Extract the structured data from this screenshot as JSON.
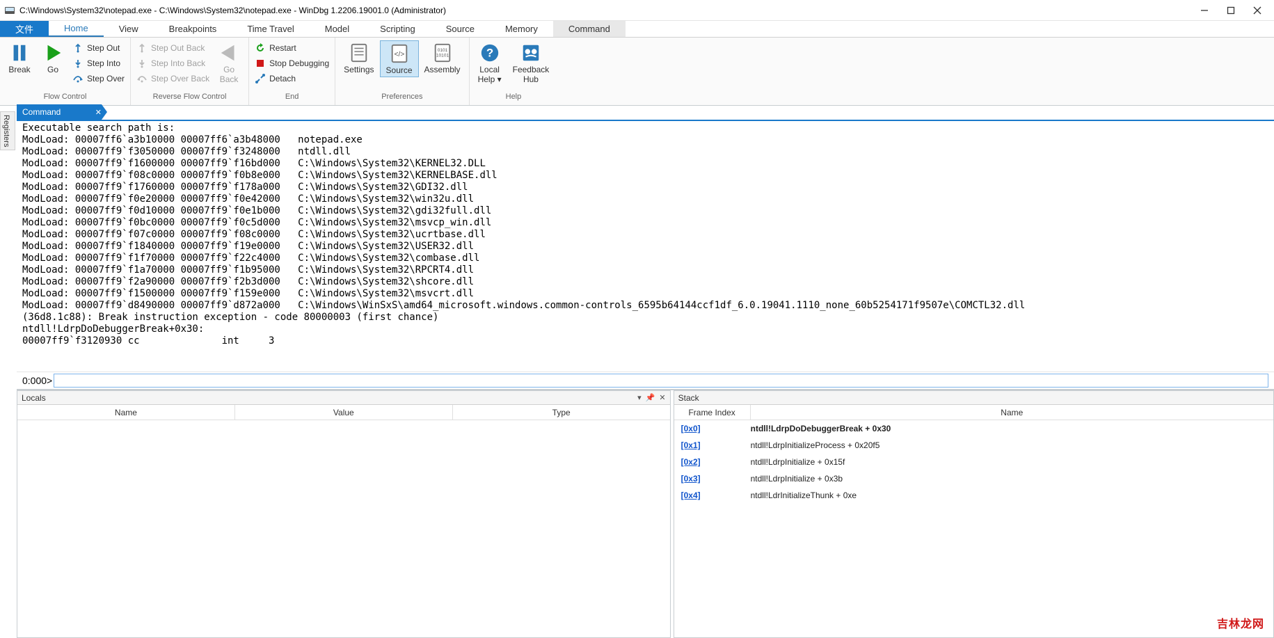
{
  "title": "C:\\Windows\\System32\\notepad.exe - C:\\Windows\\System32\\notepad.exe - WinDbg 1.2206.19001.0 (Administrator)",
  "tabs": {
    "file": "文件",
    "home": "Home",
    "view": "View",
    "breakpoints": "Breakpoints",
    "timetravel": "Time Travel",
    "model": "Model",
    "scripting": "Scripting",
    "source": "Source",
    "memory": "Memory",
    "command": "Command"
  },
  "ribbon": {
    "flow": {
      "label": "Flow Control",
      "break": "Break",
      "go": "Go",
      "stepout": "Step Out",
      "stepinto": "Step Into",
      "stepover": "Step Over"
    },
    "reverse": {
      "label": "Reverse Flow Control",
      "goback": "Go\nBack",
      "stepoutback": "Step Out Back",
      "stepintoback": "Step Into Back",
      "stepoverback": "Step Over Back"
    },
    "end": {
      "label": "End",
      "restart": "Restart",
      "stop": "Stop Debugging",
      "detach": "Detach"
    },
    "prefs": {
      "label": "Preferences",
      "settings": "Settings",
      "source": "Source",
      "assembly": "Assembly"
    },
    "help": {
      "label": "Help",
      "localhelp": "Local\nHelp",
      "feedback": "Feedback\nHub"
    }
  },
  "sidetab": "Registers",
  "command_panel": "Command",
  "command_output": "Executable search path is:\nModLoad: 00007ff6`a3b10000 00007ff6`a3b48000   notepad.exe\nModLoad: 00007ff9`f3050000 00007ff9`f3248000   ntdll.dll\nModLoad: 00007ff9`f1600000 00007ff9`f16bd000   C:\\Windows\\System32\\KERNEL32.DLL\nModLoad: 00007ff9`f08c0000 00007ff9`f0b8e000   C:\\Windows\\System32\\KERNELBASE.dll\nModLoad: 00007ff9`f1760000 00007ff9`f178a000   C:\\Windows\\System32\\GDI32.dll\nModLoad: 00007ff9`f0e20000 00007ff9`f0e42000   C:\\Windows\\System32\\win32u.dll\nModLoad: 00007ff9`f0d10000 00007ff9`f0e1b000   C:\\Windows\\System32\\gdi32full.dll\nModLoad: 00007ff9`f0bc0000 00007ff9`f0c5d000   C:\\Windows\\System32\\msvcp_win.dll\nModLoad: 00007ff9`f07c0000 00007ff9`f08c0000   C:\\Windows\\System32\\ucrtbase.dll\nModLoad: 00007ff9`f1840000 00007ff9`f19e0000   C:\\Windows\\System32\\USER32.dll\nModLoad: 00007ff9`f1f70000 00007ff9`f22c4000   C:\\Windows\\System32\\combase.dll\nModLoad: 00007ff9`f1a70000 00007ff9`f1b95000   C:\\Windows\\System32\\RPCRT4.dll\nModLoad: 00007ff9`f2a90000 00007ff9`f2b3d000   C:\\Windows\\System32\\shcore.dll\nModLoad: 00007ff9`f1500000 00007ff9`f159e000   C:\\Windows\\System32\\msvcrt.dll\nModLoad: 00007ff9`d8490000 00007ff9`d872a000   C:\\Windows\\WinSxS\\amd64_microsoft.windows.common-controls_6595b64144ccf1df_6.0.19041.1110_none_60b5254171f9507e\\COMCTL32.dll\n(36d8.1c88): Break instruction exception - code 80000003 (first chance)\nntdll!LdrpDoDebuggerBreak+0x30:\n00007ff9`f3120930 cc              int     3",
  "prompt": "0:000>",
  "locals": {
    "title": "Locals",
    "cols": [
      "Name",
      "Value",
      "Type"
    ]
  },
  "stack": {
    "title": "Stack",
    "cols": [
      "Frame Index",
      "Name"
    ],
    "rows": [
      {
        "idx": "[0x0]",
        "name": "ntdll!LdrpDoDebuggerBreak + 0x30",
        "active": true
      },
      {
        "idx": "[0x1]",
        "name": "ntdll!LdrpInitializeProcess + 0x20f5",
        "active": false
      },
      {
        "idx": "[0x2]",
        "name": "ntdll!LdrpInitialize + 0x15f",
        "active": false
      },
      {
        "idx": "[0x3]",
        "name": "ntdll!LdrpInitialize + 0x3b",
        "active": false
      },
      {
        "idx": "[0x4]",
        "name": "ntdll!LdrInitializeThunk + 0xe",
        "active": false
      }
    ]
  },
  "watermark": "吉林龙网"
}
